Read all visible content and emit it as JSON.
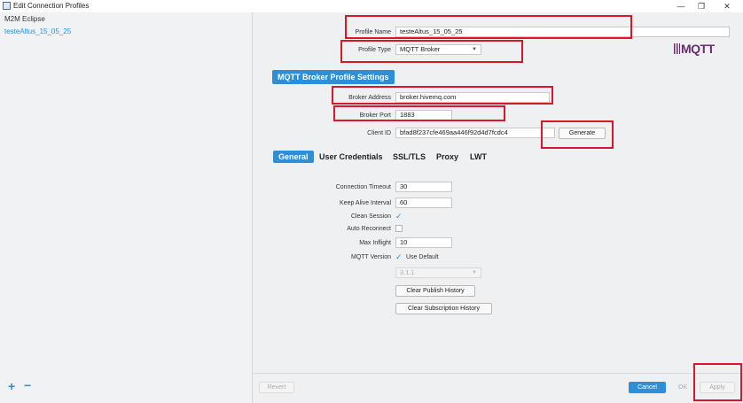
{
  "window": {
    "title": "Edit Connection Profiles",
    "minimize": "—",
    "maximize": "❐",
    "close": "✕"
  },
  "sidebar": {
    "group": "M2M Eclipse",
    "profiles": [
      "testeAltus_15_05_25"
    ],
    "add": "+",
    "remove": "−"
  },
  "profile": {
    "name_label": "Profile Name",
    "name_value": "testeAltus_15_05_25",
    "type_label": "Profile Type",
    "type_value": "MQTT Broker"
  },
  "logo": {
    "text": "MQTT"
  },
  "broker": {
    "section_title": "MQTT Broker Profile Settings",
    "address_label": "Broker Address",
    "address_value": "broker.hivemq.com",
    "port_label": "Broker Port",
    "port_value": "1883",
    "client_id_label": "Client ID",
    "client_id_value": "bfad8f237cfe469aa446f92d4d7fcdc4",
    "generate_label": "Generate"
  },
  "tabs": [
    {
      "label": "General",
      "active": true
    },
    {
      "label": "User Credentials",
      "active": false
    },
    {
      "label": "SSL/TLS",
      "active": false
    },
    {
      "label": "Proxy",
      "active": false
    },
    {
      "label": "LWT",
      "active": false
    }
  ],
  "general": {
    "connection_timeout_label": "Connection Timeout",
    "connection_timeout_value": "30",
    "keep_alive_label": "Keep Alive Interval",
    "keep_alive_value": "60",
    "clean_session_label": "Clean Session",
    "clean_session_checked": true,
    "auto_reconnect_label": "Auto Reconnect",
    "auto_reconnect_checked": false,
    "max_inflight_label": "Max Inflight",
    "max_inflight_value": "10",
    "mqtt_version_label": "MQTT Version",
    "use_default_label": "Use Default",
    "use_default_checked": true,
    "version_value": "3.1.1",
    "clear_publish_label": "Clear Publish History",
    "clear_subscription_label": "Clear Subscription History"
  },
  "footer": {
    "revert_label": "Revert",
    "cancel_label": "Cancel",
    "ok_label": "OK",
    "apply_label": "Apply"
  },
  "colors": {
    "accent": "#2e8fd6",
    "highlight_box": "#d8182a",
    "mqtt_logo": "#6b2c6e"
  }
}
